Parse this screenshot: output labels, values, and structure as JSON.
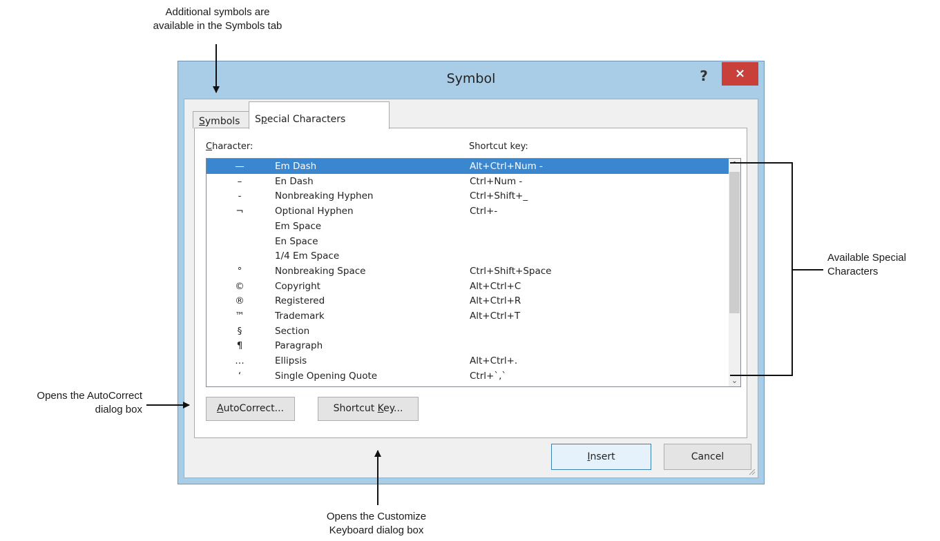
{
  "callouts": {
    "symbols_tab_note": [
      "Additional symbols are",
      "available in the Symbols tab"
    ],
    "special_chars_note": [
      "Available Special",
      "Characters"
    ],
    "autocorrect_note": [
      "Opens the AutoCorrect",
      "dialog box"
    ],
    "shortcut_note": [
      "Opens the Customize",
      "Keyboard dialog box"
    ]
  },
  "dialog": {
    "title": "Symbol",
    "help_label": "?",
    "close_label": "×",
    "tabs": [
      {
        "pre": "",
        "accel": "S",
        "post": "ymbols"
      },
      {
        "pre": "S",
        "accel": "p",
        "post": "ecial Characters"
      }
    ],
    "headers": {
      "character": {
        "accel": "C",
        "post": "haracter:"
      },
      "shortcut": "Shortcut key:"
    },
    "rows": [
      {
        "char": "—",
        "name": "Em Dash",
        "shortcut": "Alt+Ctrl+Num -",
        "selected": true
      },
      {
        "char": "–",
        "name": "En Dash",
        "shortcut": "Ctrl+Num -"
      },
      {
        "char": "-",
        "name": "Nonbreaking Hyphen",
        "shortcut": "Ctrl+Shift+_"
      },
      {
        "char": "¬",
        "name": "Optional Hyphen",
        "shortcut": "Ctrl+-"
      },
      {
        "char": "",
        "name": "Em Space",
        "shortcut": ""
      },
      {
        "char": "",
        "name": "En Space",
        "shortcut": ""
      },
      {
        "char": "",
        "name": "1/4 Em Space",
        "shortcut": ""
      },
      {
        "char": "°",
        "name": "Nonbreaking Space",
        "shortcut": "Ctrl+Shift+Space"
      },
      {
        "char": "©",
        "name": "Copyright",
        "shortcut": "Alt+Ctrl+C"
      },
      {
        "char": "®",
        "name": "Registered",
        "shortcut": "Alt+Ctrl+R"
      },
      {
        "char": "™",
        "name": "Trademark",
        "shortcut": "Alt+Ctrl+T"
      },
      {
        "char": "§",
        "name": "Section",
        "shortcut": ""
      },
      {
        "char": "¶",
        "name": "Paragraph",
        "shortcut": ""
      },
      {
        "char": "…",
        "name": "Ellipsis",
        "shortcut": "Alt+Ctrl+."
      },
      {
        "char": "‘",
        "name": "Single Opening Quote",
        "shortcut": "Ctrl+`,`"
      }
    ],
    "scroll_up": "^",
    "scroll_down": "⌄",
    "buttons": {
      "autocorrect": {
        "pre": "",
        "accel": "A",
        "post": "utoCorrect..."
      },
      "shortcut_key": {
        "pre": "Shortcut ",
        "accel": "K",
        "post": "ey..."
      },
      "insert": {
        "pre": "",
        "accel": "I",
        "post": "nsert"
      },
      "cancel": "Cancel"
    }
  },
  "colors": {
    "frame": "#a9cde6",
    "close": "#c9403a",
    "selection": "#3a87d0"
  }
}
